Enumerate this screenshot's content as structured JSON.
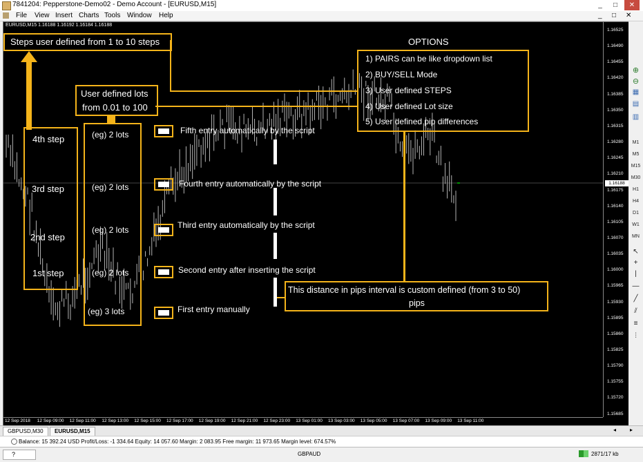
{
  "window": {
    "title": "7841204: Pepperstone-Demo02 - Demo Account - [EURUSD,M15]",
    "minimize_label": "_",
    "restore_label": "□",
    "close_label": "✕",
    "inner_minimize_label": "_",
    "inner_restore_label": "□",
    "inner_close_label": "✕"
  },
  "menu": [
    "File",
    "View",
    "Insert",
    "Charts",
    "Tools",
    "Window",
    "Help"
  ],
  "chart": {
    "symbol_header": "EURUSD,M15  1.16188 1.16192 1.16184 1.16188",
    "current_price": "1.16188",
    "price_ticks": [
      "1.16525",
      "1.16490",
      "1.16455",
      "1.16420",
      "1.16385",
      "1.16350",
      "1.16315",
      "1.16280",
      "1.16245",
      "1.16210",
      "1.16175",
      "1.16140",
      "1.16105",
      "1.16070",
      "1.16035",
      "1.16000",
      "1.15965",
      "1.15930",
      "1.15895",
      "1.15860",
      "1.15825",
      "1.15790",
      "1.15755",
      "1.15720",
      "1.15685"
    ],
    "time_ticks": [
      "12 Sep 2018",
      "12 Sep 09:00",
      "12 Sep 11:00",
      "12 Sep 13:00",
      "12 Sep 15:00",
      "12 Sep 17:00",
      "12 Sep 19:00",
      "12 Sep 21:00",
      "12 Sep 23:00",
      "13 Sep 01:00",
      "13 Sep 03:00",
      "13 Sep 05:00",
      "13 Sep 07:00",
      "13 Sep 09:00",
      "13 Sep 11:00"
    ]
  },
  "annotations": {
    "steps_title": "Steps user defined from 1 to 10 steps",
    "steps": [
      "4th step",
      "3rd step",
      "2nd step",
      "1st step"
    ],
    "lots_title_line1": "User defined lots",
    "lots_title_line2": "from 0.01 to 100",
    "lots": [
      "(eg) 2 lots",
      "(eg) 2 lots",
      "(eg) 2 lots",
      "(eg) 2 lots",
      "(eg) 3 lots"
    ],
    "entries": [
      "Fifth entry automatically by the script",
      "Fourth  entry automatically by the script",
      "Third  entry automatically by the script",
      "Second entry after inserting the script",
      "First entry manually"
    ],
    "options_title": "OPTIONS",
    "options": [
      "1) PAIRS can be like dropdown list",
      "2) BUY/SELL Mode",
      "3) User defined STEPS",
      "4) User defined Lot size",
      "5) User defined pip differences"
    ],
    "pips_line1": "This distance in pips interval is custom defined (from 3 to 50)",
    "pips_line2": "pips"
  },
  "right_toolbar": [
    "M1",
    "M5",
    "M15",
    "M30",
    "H1",
    "H4",
    "D1",
    "W1",
    "MN"
  ],
  "tabs": [
    "GBPUSD,M30",
    "EURUSD,M15"
  ],
  "balance": "Balance: 15 392.24 USD  Profit/Loss: -1 334.64  Equity: 14 057.60  Margin: 2 083.95  Free margin: 11 973.65  Margin level: 674.57%",
  "status": {
    "left_box": "",
    "symbol": "GBPAUD",
    "traffic": "2871/17 kb"
  },
  "colors": {
    "annotation": "#f5b41a",
    "chart_bg": "#000000",
    "candle": "#cfcfcf",
    "current_tick": "#00c000"
  }
}
